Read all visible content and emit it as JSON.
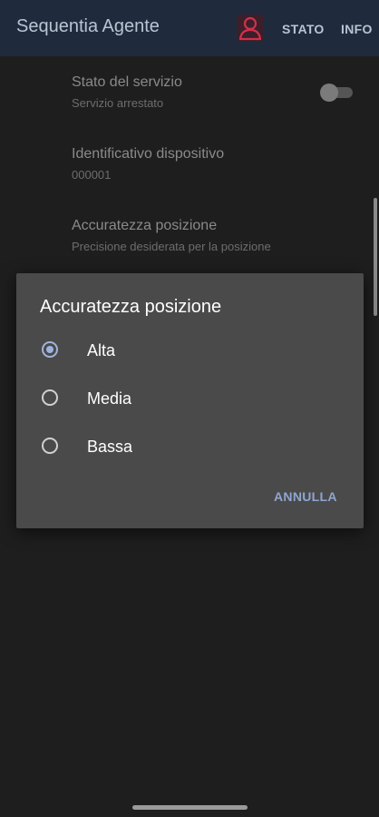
{
  "appbar": {
    "title": "Sequentia Agente",
    "actions": [
      "STATO",
      "INFO"
    ]
  },
  "preferences": [
    {
      "title": "Stato del servizio",
      "summary": "Servizio arrestato",
      "switch_on": false
    },
    {
      "title": "Identificativo dispositivo",
      "summary": "000001"
    },
    {
      "title": "Accuratezza posizione",
      "summary": "Precisione desiderata per la posizione"
    }
  ],
  "dialog": {
    "title": "Accuratezza posizione",
    "options": [
      {
        "label": "Alta",
        "selected": true
      },
      {
        "label": "Media",
        "selected": false
      },
      {
        "label": "Bassa",
        "selected": false
      }
    ],
    "cancel_label": "ANNULLA"
  },
  "colors": {
    "appbar": "#1f2b3d",
    "background": "#1e1e1e",
    "dialog": "#4a4a4a",
    "accent": "#9fb3dd",
    "user_icon": "#d0314a"
  },
  "icons": {
    "user": "user-icon"
  }
}
